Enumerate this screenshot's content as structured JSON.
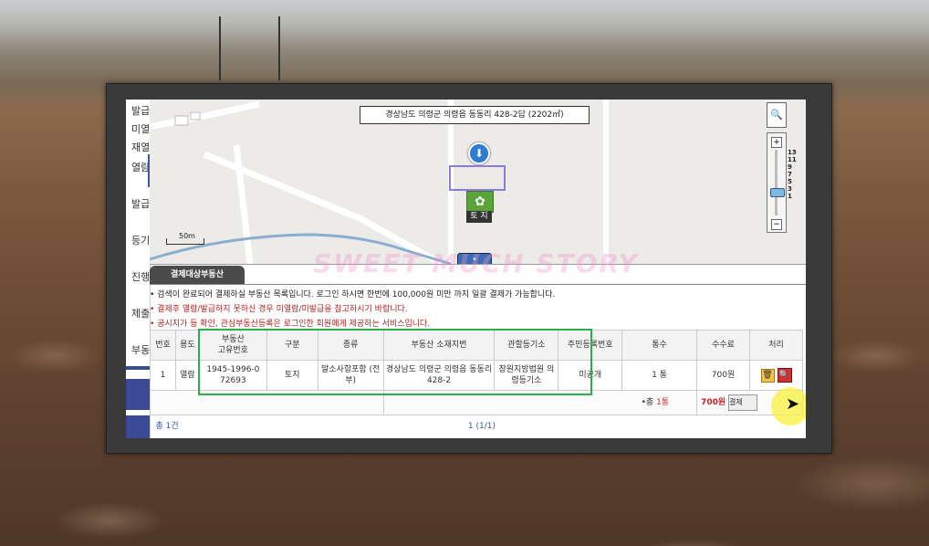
{
  "sidebar": {
    "items": [
      {
        "label": "발급"
      },
      {
        "label": "미열"
      },
      {
        "label": "재열"
      },
      {
        "label": "열람"
      },
      {
        "label": "발급확"
      },
      {
        "label": "등기신"
      },
      {
        "label": "진행등"
      },
      {
        "label": "제출등"
      },
      {
        "label": "부동산"
      }
    ]
  },
  "map": {
    "title": "경상남도 의령군 의령읍 동동리 428-2답 (2202㎡)",
    "scale_label": "50m",
    "land_icon_label": "토 지",
    "zoom_levels": [
      "13",
      "11",
      "9",
      "7",
      "5",
      "3",
      "1"
    ],
    "zoom_plus": "+",
    "zoom_minus": "−"
  },
  "watermark": "SWEET MUCH STORY",
  "section": {
    "tab_label": "결제대상부동산",
    "notes": [
      "• 검색이 완료되어 결제하실 부동산 목록입니다.  로그인 하시면 한번에 100,000원 미만 까지 일괄 결제가 가능합니다.",
      "• 결제후 열람/발급하지 못하신 경우 미열람/미발급을 참고하시기 바랍니다.",
      "• 공시지가 등 확인, 관심부동산등록은 로그인한 회원에게 제공하는 서비스입니다."
    ]
  },
  "table": {
    "headers": [
      "번호",
      "용도",
      "부동산\n고유번호",
      "구분",
      "종류",
      "부동산 소재지번",
      "관할등기소",
      "주민등록번호",
      "통수",
      "수수료",
      "처리"
    ],
    "rows": [
      {
        "no": "1",
        "use": "열람",
        "unique_no": "1945-1996-0 72693",
        "category": "토지",
        "type": "말소사항포함 (전부)",
        "address": "경상남도 의령군 의령읍 동동리 428-2",
        "registry": "창원지방법원 의령등기소",
        "resident_no": "미공개",
        "copies": "1 통",
        "fee": "700원"
      }
    ],
    "total_copies_label": "•총",
    "total_copies_value": "1통",
    "total_fee": "700원",
    "pay_label": "결제",
    "footer_total": "총 1건",
    "pagination": "1  (1/1)"
  }
}
